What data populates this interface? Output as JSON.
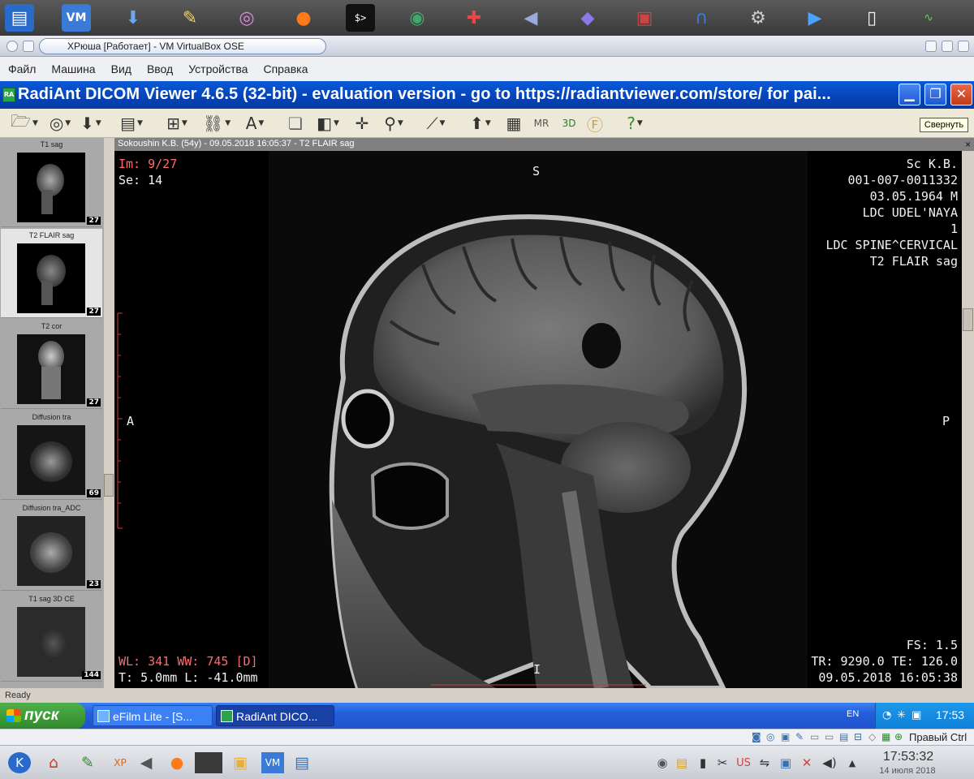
{
  "host_panel": {
    "icons": [
      "document-icon",
      "vbox-icon",
      "download-icon",
      "editor-icon",
      "disc-icon",
      "firefox-icon",
      "terminal-icon",
      "globe-icon",
      "cursor-icon",
      "audio-icon",
      "cube-icon",
      "display-icon",
      "headphones-icon",
      "settings-icon",
      "media-player-icon",
      "blank-page-icon",
      "system-monitor-icon"
    ]
  },
  "vbox": {
    "title": "ХРюша [Работает] - VM VirtualBox OSE",
    "menu": [
      "Файл",
      "Машина",
      "Вид",
      "Ввод",
      "Устройства",
      "Справка"
    ],
    "status_right": "Правый Ctrl"
  },
  "app": {
    "title": "RadiAnt DICOM Viewer 4.6.5 (32-bit) - evaluation version - go to https://radiantviewer.com/store/ for pai...",
    "tooltip": "Свернуть",
    "status": "Ready"
  },
  "series": [
    {
      "label": "T1 sag",
      "count": "27"
    },
    {
      "label": "T2 FLAIR sag",
      "count": "27",
      "selected": true
    },
    {
      "label": "T2 cor",
      "count": "27"
    },
    {
      "label": "Diffusion tra",
      "count": "69"
    },
    {
      "label": "Diffusion tra_ADC",
      "count": "23"
    },
    {
      "label": "T1 sag 3D CE",
      "count": "144"
    }
  ],
  "viewer": {
    "header": "Sokoushin K.B. (54y) - 09.05.2018 16:05:37 - T2 FLAIR sag",
    "close": "×",
    "top_left": [
      "Im: 9/27",
      "Se: 14"
    ],
    "top_right": [
      "Sc        K.B.",
      "001-007-0011332",
      "03.05.1964 M",
      "LDC UDEL'NAYA",
      "1",
      "LDC SPINE^CERVICAL",
      "T2 FLAIR sag"
    ],
    "orient": {
      "top": "S",
      "left": "A",
      "right": "P",
      "bottom": "I"
    },
    "bottom_left": [
      "WL: 341 WW: 745 [D]",
      "T: 5.0mm L: -41.0mm"
    ],
    "bottom_right": [
      "FS: 1.5",
      "TR: 9290.0 TE: 126.0",
      "09.05.2018 16:05:38"
    ]
  },
  "taskbar": {
    "start": "пуск",
    "tasks": [
      "eFilm Lite - [S...",
      "RadiAnt DICO..."
    ],
    "lang": "EN",
    "clock": "17:53"
  },
  "host_bottom": {
    "clock": "17:53:32",
    "date": "14 июля 2018"
  }
}
